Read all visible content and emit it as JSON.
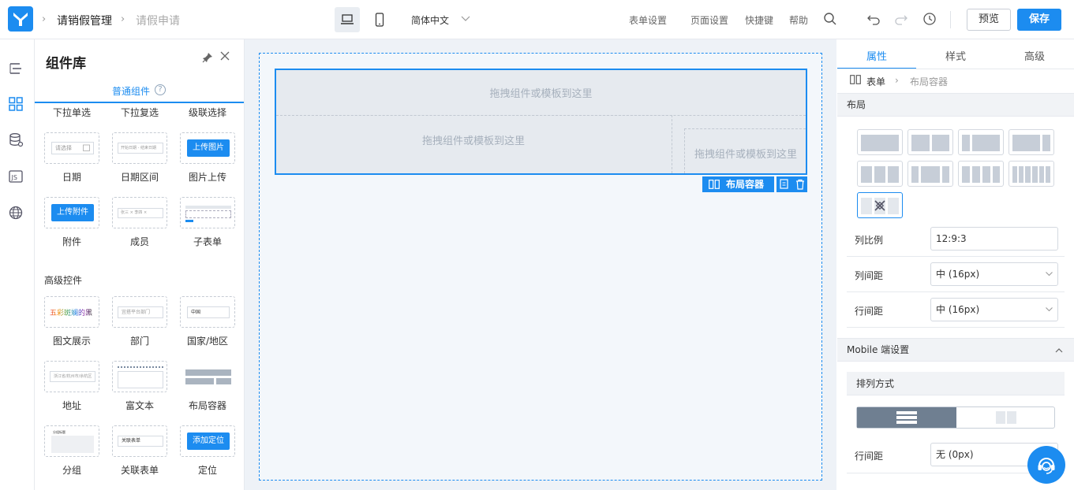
{
  "header": {
    "app_title": "请销假管理",
    "page_title": "请假申请",
    "language": "简体中文",
    "links": [
      "表单设置",
      "页面设置",
      "快捷键",
      "帮助"
    ],
    "preview_label": "预览",
    "save_label": "保存"
  },
  "library": {
    "title": "组件库",
    "tab_label": "普通组件",
    "help_glyph": "?",
    "top_row": [
      "下拉单选",
      "下拉复选",
      "级联选择"
    ],
    "date_placeholder": "请选择",
    "range_start": "开始日期",
    "range_end": "结束日期",
    "upload_image": "上传图片",
    "upload_file": "上传附件",
    "member_a": "张三",
    "member_b": "李四",
    "labels_row1": [
      "日期",
      "日期区间",
      "图片上传"
    ],
    "labels_row2": [
      "附件",
      "成员",
      "子表单"
    ],
    "advanced_title": "高级控件",
    "rich_text_sample": "五彩斑斓的黑",
    "dept_placeholder": "宜搭平台部门",
    "country_value": "中国",
    "address_placeholder": "浙江省/杭州市/余杭区",
    "labels_row3": [
      "图文展示",
      "部门",
      "国家/地区"
    ],
    "labels_row4": [
      "地址",
      "富文本",
      "布局容器"
    ],
    "group_title": "分组标题",
    "related_value": "关联表单",
    "locate_button": "添加定位",
    "labels_row5": [
      "分组",
      "关联表单",
      "定位"
    ]
  },
  "canvas": {
    "drop_hint": "拖拽组件或模板到这里",
    "container_label": "布局容器"
  },
  "props": {
    "tabs": [
      "属性",
      "样式",
      "高级"
    ],
    "crumb_root": "表单",
    "crumb_current": "布局容器",
    "layout_band": "布局",
    "ratio_label": "列比例",
    "ratio_value": "12:9:3",
    "col_gap_label": "列间距",
    "col_gap_value": "中 (16px)",
    "row_gap_label": "行间距",
    "row_gap_value": "中 (16px)",
    "mobile_band": "Mobile 端设置",
    "arrange_label": "排列方式",
    "mobile_row_gap_label": "行间距",
    "mobile_row_gap_value": "无 (0px)"
  },
  "colors": {
    "accent": "#1c8cf0"
  }
}
